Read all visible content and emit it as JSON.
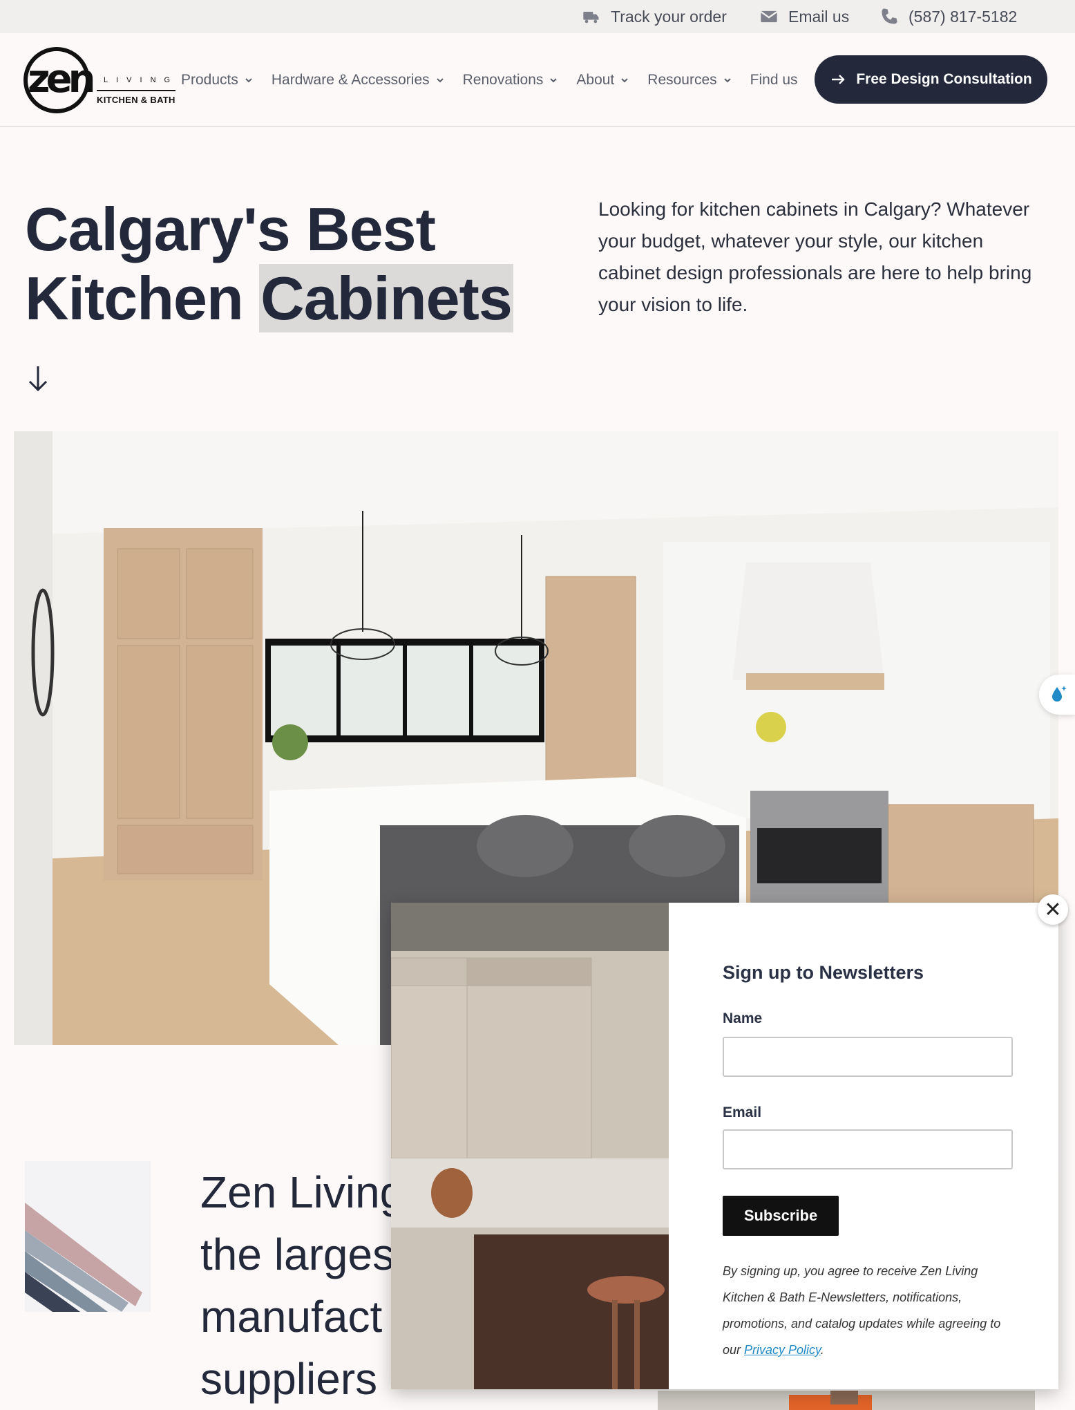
{
  "topbar": {
    "track_order": "Track your order",
    "email": "Email us",
    "phone": "(587) 817-5182"
  },
  "logo": {
    "mark": "zen",
    "living": "LIVING",
    "subtitle": "KITCHEN & BATH"
  },
  "nav": {
    "items": [
      {
        "label": "Products"
      },
      {
        "label": "Hardware & Accessories"
      },
      {
        "label": "Renovations"
      },
      {
        "label": "About"
      },
      {
        "label": "Resources"
      },
      {
        "label": "Find us"
      }
    ],
    "cta_label": "Free Design Consultation"
  },
  "hero": {
    "title_line1": "Calgary's Best",
    "title_line2_a": "Kitchen ",
    "title_line2_highlight": "Cabinets",
    "text": "Looking for kitchen cabinets in Calgary? Whatever your budget, whatever your style, our kitchen cabinet design professionals are here to help bring your vision to life."
  },
  "section2": {
    "lines": [
      "Zen Living",
      "the larges",
      "manufact",
      "suppliers"
    ]
  },
  "popup": {
    "title": "Sign up to Newsletters",
    "name_label": "Name",
    "email_label": "Email",
    "subscribe_label": "Subscribe",
    "disclaimer": "By signing up, you agree to receive Zen Living Kitchen & Bath E-Newsletters, notifications, promotions, and catalog updates while agreeing to our ",
    "privacy_link": "Privacy Policy",
    "disclaimer_end": ".",
    "close_label": "✕"
  },
  "icons": [
    "truck-icon",
    "envelope-icon",
    "phone-icon",
    "chevron-down-icon",
    "arrow-right-icon",
    "arrow-down-icon",
    "water-drop-icon",
    "close-icon"
  ],
  "colors": {
    "navy": "#23283a",
    "highlight": "#dcdad9",
    "link": "#1f8ac7"
  }
}
